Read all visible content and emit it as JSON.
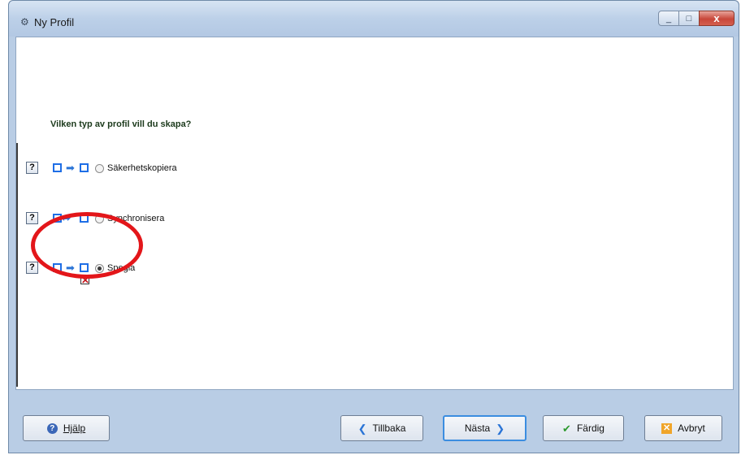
{
  "window": {
    "title": "Ny Profil",
    "title_icon": "gear-icon",
    "controls": {
      "minimize": "_",
      "maximize": "□",
      "close": "x"
    }
  },
  "main": {
    "question": "Vilken typ av profil vill du skapa?",
    "options": [
      {
        "label": "Säkerhetskopiera",
        "selected": false,
        "help": "?",
        "arrow": "➡",
        "icon": "backup-arrow-icon"
      },
      {
        "label": "Synchronisera",
        "selected": false,
        "help": "?",
        "arrow": "⬌",
        "icon": "sync-arrows-icon"
      },
      {
        "label": "Spegla",
        "selected": true,
        "help": "?",
        "arrow": "➡",
        "icon": "mirror-arrow-icon",
        "extra_icon_glyph": "✕"
      }
    ]
  },
  "footer": {
    "help": {
      "label": "Hjälp",
      "icon": "help-icon",
      "glyph": "?"
    },
    "back": {
      "label": "Tillbaka",
      "icon": "chevron-left-icon",
      "glyph": "❮"
    },
    "next": {
      "label": "Nästa",
      "icon": "chevron-right-icon",
      "glyph": "❯"
    },
    "finish": {
      "label": "Färdig",
      "icon": "check-icon",
      "glyph": "✔"
    },
    "cancel": {
      "label": "Avbryt",
      "icon": "cancel-icon",
      "glyph": "✕"
    }
  },
  "colors": {
    "accent": "#1e6ee6",
    "highlight": "#e3161a",
    "finish_check": "#2e9a2e"
  }
}
